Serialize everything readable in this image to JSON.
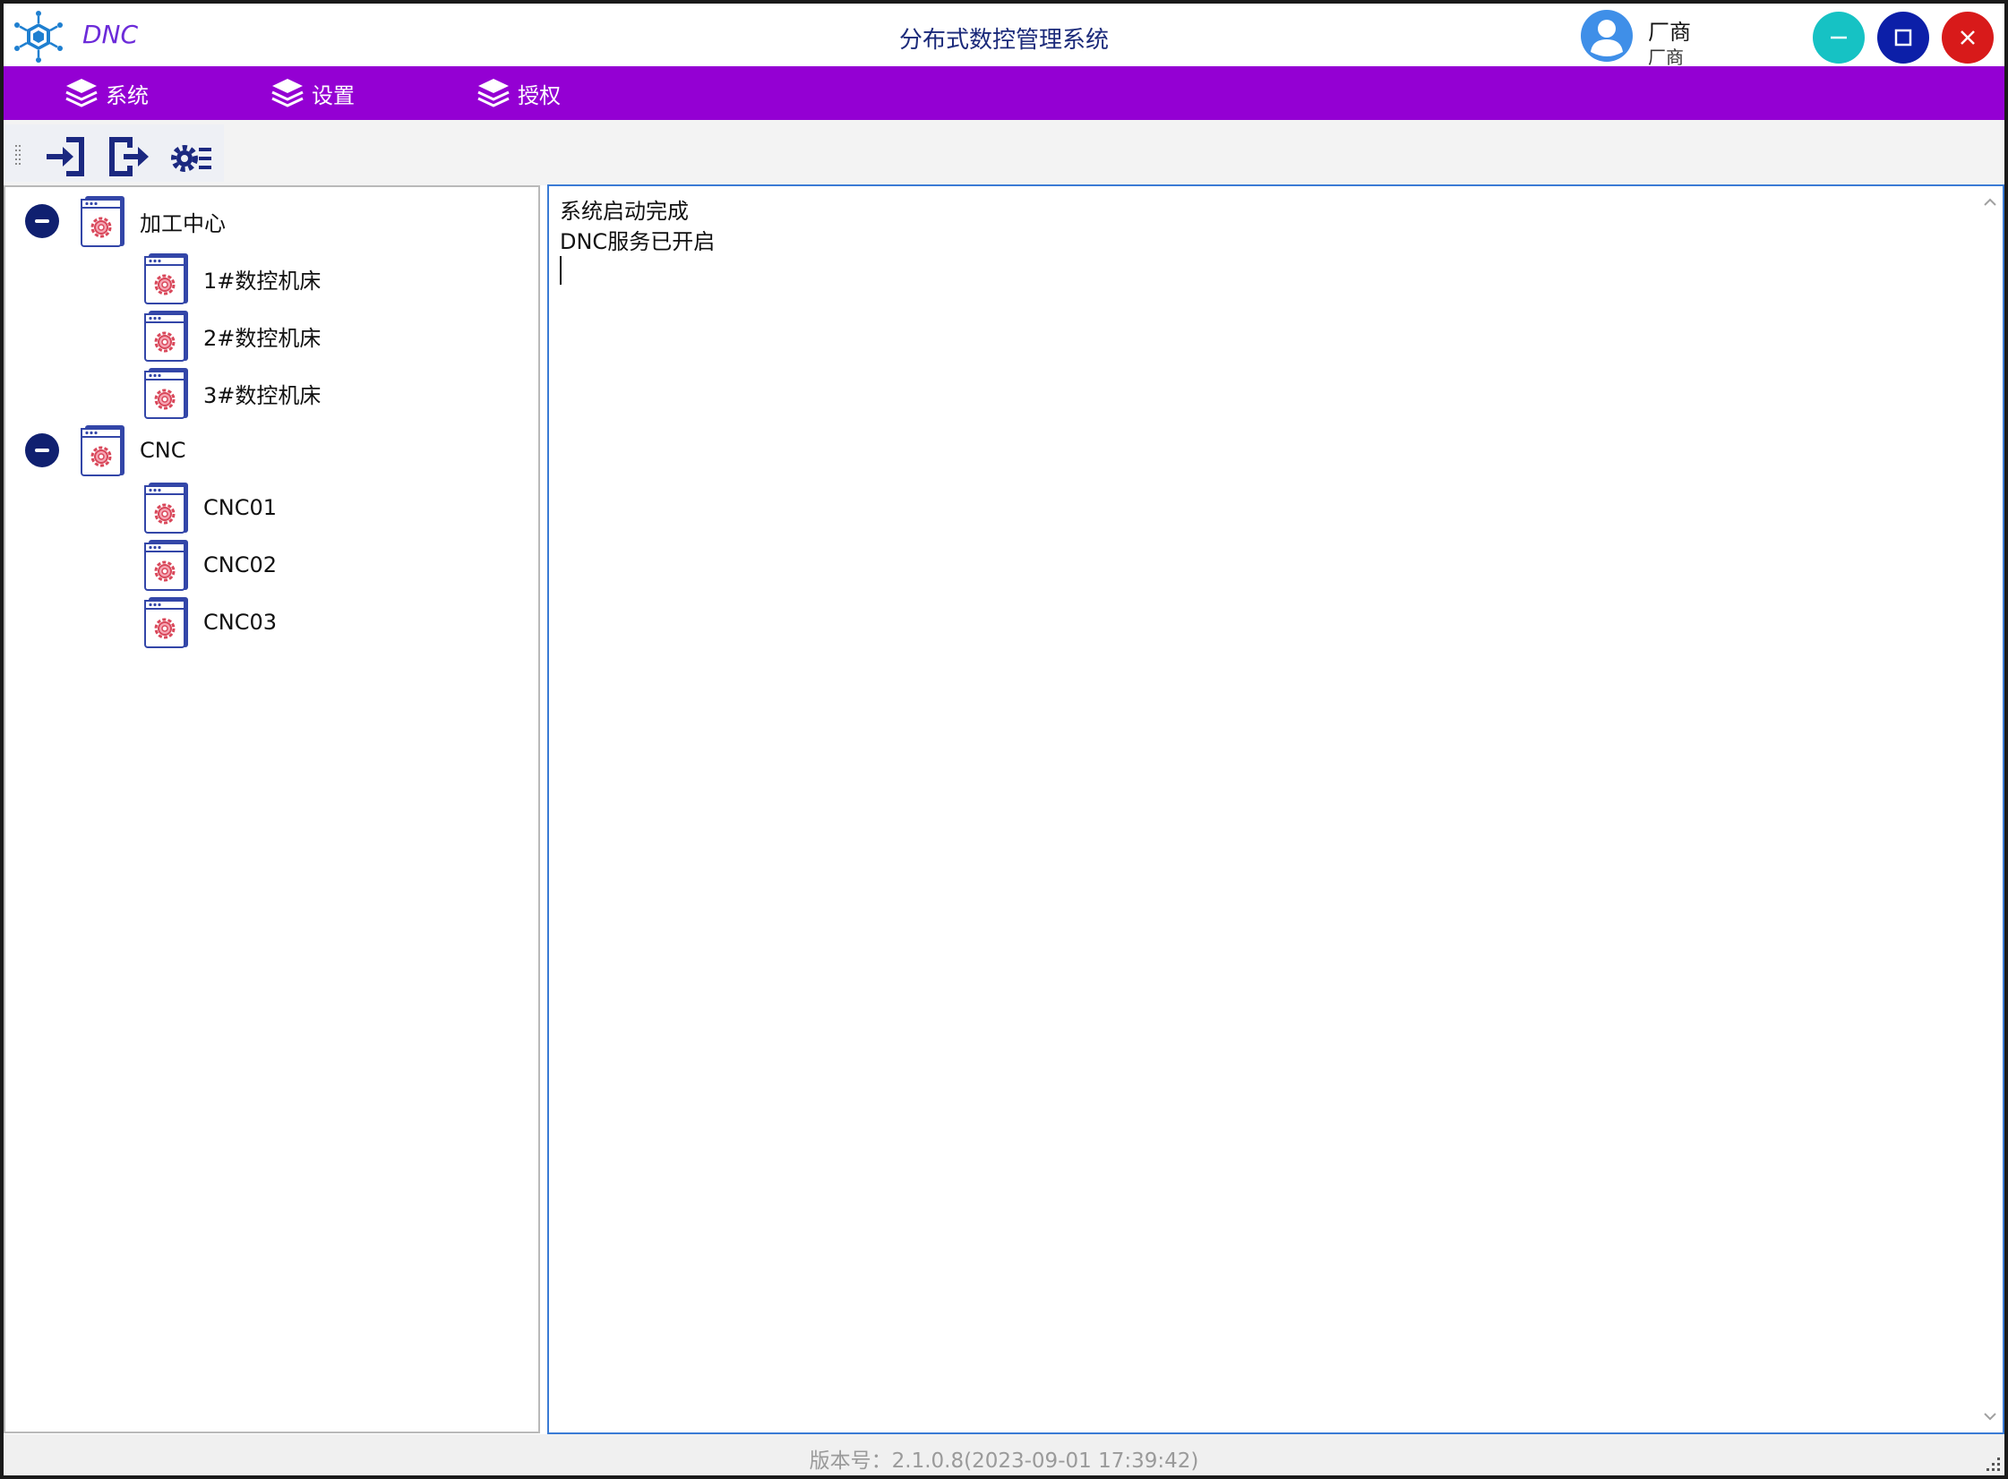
{
  "titlebar": {
    "app_name": "DNC",
    "title": "分布式数控管理系统",
    "user_name": "厂商",
    "user_role": "厂商"
  },
  "menu": [
    {
      "label": "系统",
      "icon": "layers-icon"
    },
    {
      "label": "设置",
      "icon": "layers-icon"
    },
    {
      "label": "授权",
      "icon": "layers-icon"
    }
  ],
  "toolbar": {
    "buttons": [
      {
        "icon": "login-icon"
      },
      {
        "icon": "logout-icon"
      },
      {
        "icon": "settings-list-icon"
      }
    ]
  },
  "tree": {
    "groups": [
      {
        "label": "加工中心",
        "expanded": true,
        "children": [
          {
            "label": "1#数控机床"
          },
          {
            "label": "2#数控机床"
          },
          {
            "label": "3#数控机床"
          }
        ]
      },
      {
        "label": "CNC",
        "expanded": true,
        "children": [
          {
            "label": "CNC01"
          },
          {
            "label": "CNC02"
          },
          {
            "label": "CNC03"
          }
        ]
      }
    ]
  },
  "log": {
    "lines": [
      "系统启动完成",
      "DNC服务已开启"
    ]
  },
  "status": {
    "version": "版本号：2.1.0.8(2023-09-01 17:39:42)"
  },
  "colors": {
    "menu_bg": "#9400d3",
    "minimize": "#16c2c4",
    "maximize": "#0c1fa8",
    "close": "#d81a1a",
    "tree_toggle": "#102070",
    "log_border": "#3a7bd5"
  }
}
